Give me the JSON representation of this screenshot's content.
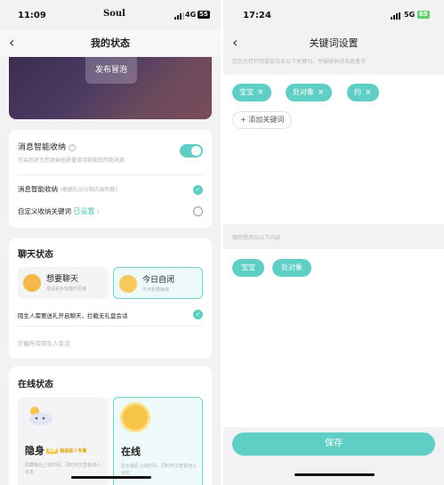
{
  "left": {
    "status": {
      "time": "11:09",
      "center": "Soul",
      "network": "4G",
      "battery": "55"
    },
    "nav": {
      "back_icon": "‹",
      "title": "我的状态"
    },
    "banner": {
      "publish_label": "发布冒泡"
    },
    "smart_fold": {
      "title": "消息智能收纳",
      "subtitle": "开启后将为您收纳低质量或可能取扰的陌消息",
      "enabled": true,
      "option1": "消息智能收纳",
      "option1_note": "(根据礼仪分和内容判断)",
      "option2": "自定义收纳关键词",
      "option2_link": "已设置 ›"
    },
    "chat": {
      "heading": "聊天状态",
      "options": [
        {
          "title": "想要聊天",
          "sub": "邀请更多有趣的灵魂"
        },
        {
          "title": "今日自闭",
          "sub": "今天想要静静"
        }
      ],
      "rule1": "陌生人需要送礼开启聊天，拦截无礼盘会话",
      "rule2": "拦截所有陌生人会话"
    },
    "online": {
      "heading": "在线状态",
      "options": [
        {
          "title": "隐身",
          "vip": "VIP",
          "vip_note": "超级星人专属",
          "sub": "隐藏最后上线时间，同时无法查看他人状态"
        },
        {
          "title": "在线",
          "sub": "显示最后上线时间，同时可以查看他人状态"
        }
      ]
    }
  },
  "right": {
    "status": {
      "time": "17:24",
      "network": "5G",
      "battery": "65"
    },
    "nav": {
      "back_icon": "‹",
      "title": "关键词设置"
    },
    "hint1": "您的为打开陌语会包含以下关键词，并被收纳进消息盒子",
    "chips": [
      "宝宝",
      "处对象",
      "约"
    ],
    "chip_close": "×",
    "add_label": "+ 添加关键词",
    "hint2": "猜你想添加以下内容",
    "suggestions": [
      "宝宝",
      "处对象"
    ],
    "save_label": "保存"
  },
  "colors": {
    "accent": "#5fcfc6",
    "background": "#f2f2f4"
  }
}
